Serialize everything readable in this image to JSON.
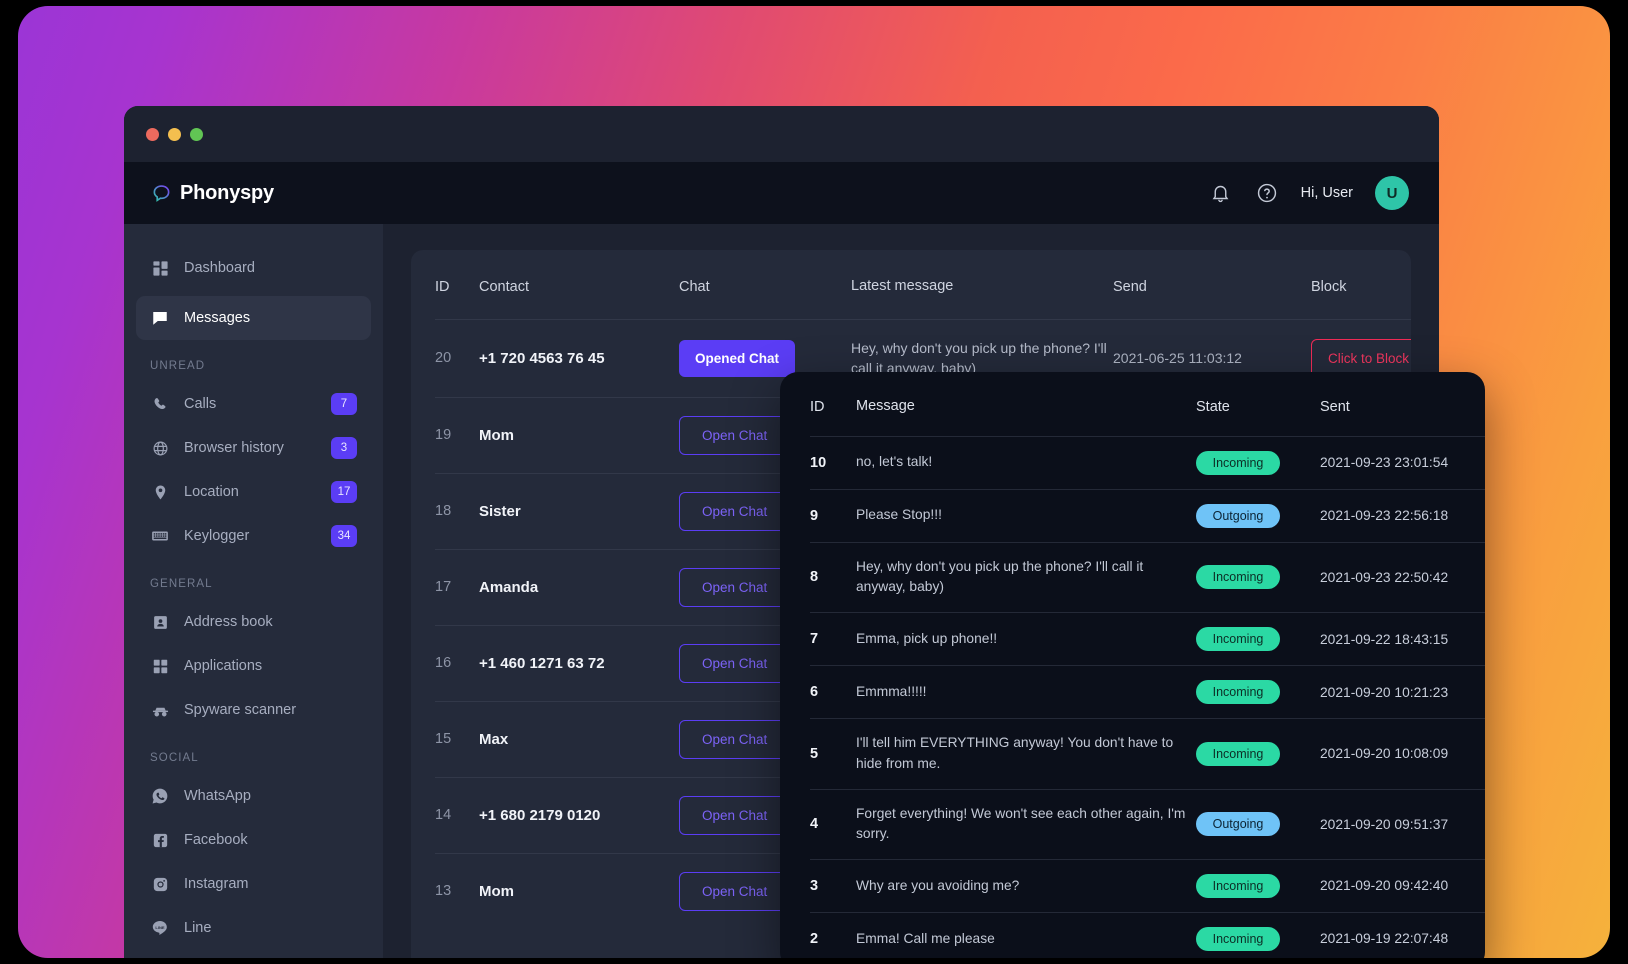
{
  "brand": {
    "name": "Phonyspy",
    "logo_icon": "speech-bubble-icon",
    "logo_gradient_from": "#2ec5a8",
    "logo_gradient_to": "#7b3df5"
  },
  "window_controls": {
    "close": "close-dot",
    "minimize": "minimize-dot",
    "maximize": "maximize-dot",
    "close_color": "#ec6a5e",
    "minimize_color": "#f4bf4f",
    "maximize_color": "#61c554"
  },
  "topbar": {
    "notifications_icon": "bell-icon",
    "help_icon": "question-circle-icon",
    "greeting": "Hi, User",
    "avatar_initial": "U",
    "avatar_color": "#2ec5a8"
  },
  "sidebar": {
    "primary": [
      {
        "label": "Dashboard",
        "icon": "grid-icon",
        "active": false
      },
      {
        "label": "Messages",
        "icon": "chat-icon",
        "active": true
      }
    ],
    "sections": [
      {
        "title": "UNREAD",
        "items": [
          {
            "label": "Calls",
            "icon": "phone-icon",
            "badge": "7"
          },
          {
            "label": "Browser history",
            "icon": "globe-icon",
            "badge": "3"
          },
          {
            "label": "Location",
            "icon": "pin-icon",
            "badge": "17"
          },
          {
            "label": "Keylogger",
            "icon": "keyboard-icon",
            "badge": "34"
          }
        ]
      },
      {
        "title": "GENERAL",
        "items": [
          {
            "label": "Address book",
            "icon": "contact-card-icon",
            "badge": ""
          },
          {
            "label": "Applications",
            "icon": "apps-grid-icon",
            "badge": ""
          },
          {
            "label": "Spyware scanner",
            "icon": "incognito-icon",
            "badge": ""
          }
        ]
      },
      {
        "title": "SOCIAL",
        "items": [
          {
            "label": "WhatsApp",
            "icon": "whatsapp-icon",
            "badge": ""
          },
          {
            "label": "Facebook",
            "icon": "facebook-icon",
            "badge": ""
          },
          {
            "label": "Instagram",
            "icon": "instagram-icon",
            "badge": ""
          },
          {
            "label": "Line",
            "icon": "line-icon",
            "badge": ""
          }
        ]
      }
    ],
    "badge_color": "#5b3df5"
  },
  "chat_table": {
    "headers": [
      "ID",
      "Contact",
      "Chat",
      "Latest message",
      "Send",
      "Block"
    ],
    "rows": [
      {
        "id": "20",
        "contact": "+1 720 4563 76 45",
        "chat_label": "Opened Chat",
        "chat_state": "opened",
        "latest_message": "Hey, why don't you pick up the phone? I'll call it anyway, baby)",
        "send": "2021-06-25 11:03:12",
        "block_label": "Click to Block"
      },
      {
        "id": "19",
        "contact": "Mom",
        "chat_label": "Open Chat",
        "chat_state": "open",
        "latest_message": "",
        "send": "",
        "block_label": ""
      },
      {
        "id": "18",
        "contact": "Sister",
        "chat_label": "Open Chat",
        "chat_state": "open",
        "latest_message": "",
        "send": "",
        "block_label": ""
      },
      {
        "id": "17",
        "contact": "Amanda",
        "chat_label": "Open Chat",
        "chat_state": "open",
        "latest_message": "",
        "send": "",
        "block_label": ""
      },
      {
        "id": "16",
        "contact": "+1 460 1271 63 72",
        "chat_label": "Open Chat",
        "chat_state": "open",
        "latest_message": "",
        "send": "",
        "block_label": ""
      },
      {
        "id": "15",
        "contact": "Max",
        "chat_label": "Open Chat",
        "chat_state": "open",
        "latest_message": "",
        "send": "",
        "block_label": ""
      },
      {
        "id": "14",
        "contact": "+1 680 2179 0120",
        "chat_label": "Open Chat",
        "chat_state": "open",
        "latest_message": "",
        "send": "",
        "block_label": ""
      },
      {
        "id": "13",
        "contact": "Mom",
        "chat_label": "Open Chat",
        "chat_state": "open",
        "latest_message": "",
        "send": "",
        "block_label": ""
      }
    ]
  },
  "message_panel": {
    "headers": [
      "ID",
      "Message",
      "State",
      "Sent"
    ],
    "state_colors": {
      "incoming": "#2bd9a4",
      "outgoing": "#6fc3f7"
    },
    "rows": [
      {
        "id": "10",
        "message": "no, let's talk!",
        "state": "Incoming",
        "sent": "2021-09-23 23:01:54"
      },
      {
        "id": "9",
        "message": "Please Stop!!!",
        "state": "Outgoing",
        "sent": "2021-09-23 22:56:18"
      },
      {
        "id": "8",
        "message": "Hey, why don't you pick up the phone? I'll call it anyway, baby)",
        "state": "Incoming",
        "sent": "2021-09-23 22:50:42"
      },
      {
        "id": "7",
        "message": "Emma, pick up phone!!",
        "state": "Incoming",
        "sent": "2021-09-22 18:43:15"
      },
      {
        "id": "6",
        "message": "Emmma!!!!!",
        "state": "Incoming",
        "sent": "2021-09-20 10:21:23"
      },
      {
        "id": "5",
        "message": "I'll tell him EVERYTHING anyway! You don't have to hide from me.",
        "state": "Incoming",
        "sent": "2021-09-20 10:08:09"
      },
      {
        "id": "4",
        "message": "Forget everything! We won't see each other again, I'm sorry.",
        "state": "Outgoing",
        "sent": "2021-09-20 09:51:37"
      },
      {
        "id": "3",
        "message": "Why are you avoiding me?",
        "state": "Incoming",
        "sent": "2021-09-20 09:42:40"
      },
      {
        "id": "2",
        "message": "Emma! Call me please",
        "state": "Incoming",
        "sent": "2021-09-19 22:07:48"
      }
    ]
  }
}
